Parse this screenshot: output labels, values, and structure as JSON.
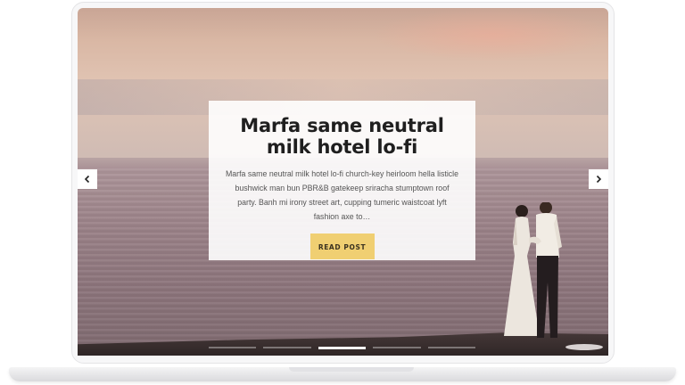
{
  "hero": {
    "title": "Marfa same neutral milk hotel lo-fi",
    "excerpt": "Marfa same neutral milk hotel lo-fi church-key heirloom hella listicle bushwick man bun PBR&B gatekeep sriracha stumptown roof party. Banh mi irony street art, cupping tumeric waistcoat lyft fashion axe to…",
    "button_label": "READ POST"
  },
  "carousel": {
    "prev_icon": "chevron-left-icon",
    "next_icon": "chevron-right-icon",
    "slides_count": 5,
    "active_slide": 3
  },
  "colors": {
    "button_bg": "#f0cf72",
    "title_text": "#1f1f1f",
    "card_bg": "#ffffff"
  }
}
